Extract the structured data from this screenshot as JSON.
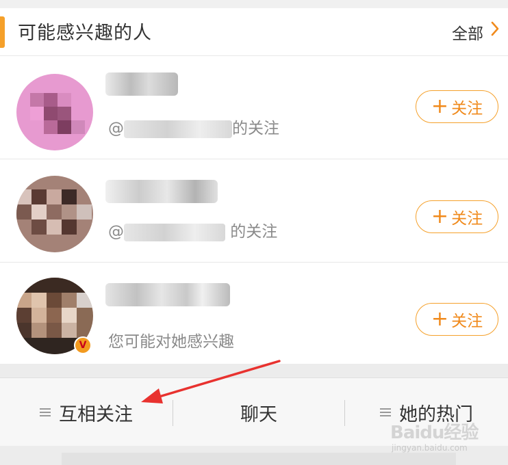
{
  "section": {
    "title": "可能感兴趣的人",
    "see_all": "全部"
  },
  "suggestions": [
    {
      "sub_prefix": "@",
      "sub_suffix": "的关注",
      "follow_label": "关注"
    },
    {
      "sub_prefix": "@",
      "sub_suffix": " 的关注",
      "follow_label": "关注"
    },
    {
      "sub_text": "您可能对她感兴趣",
      "follow_label": "关注",
      "verified": true
    }
  ],
  "tabs": [
    {
      "label": "互相关注",
      "has_menu_icon": true
    },
    {
      "label": "聊天",
      "has_menu_icon": false
    },
    {
      "label": "她的热门",
      "has_menu_icon": true
    }
  ],
  "colors": {
    "accent": "#f5a02a",
    "follow_text": "#f08a1c",
    "annotation_arrow": "#e8322f"
  },
  "watermark": {
    "logo": "Baidu经验",
    "url": "jingyan.baidu.com"
  }
}
